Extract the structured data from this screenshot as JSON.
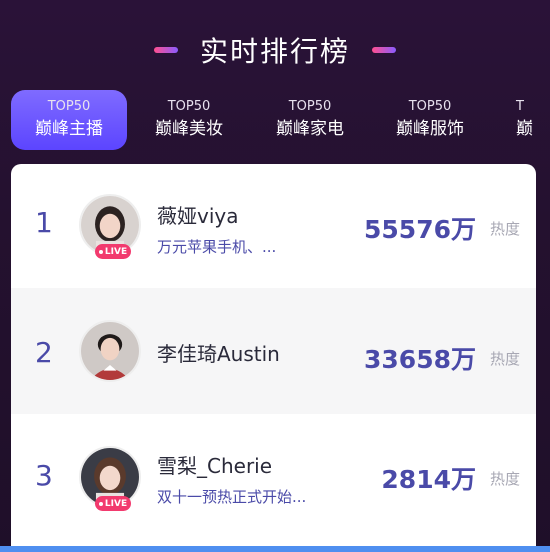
{
  "header": {
    "title": "实时排行榜"
  },
  "tabs": [
    {
      "top": "TOP50",
      "label": "巅峰主播",
      "active": true
    },
    {
      "top": "TOP50",
      "label": "巅峰美妆"
    },
    {
      "top": "TOP50",
      "label": "巅峰家电"
    },
    {
      "top": "TOP50",
      "label": "巅峰服饰"
    },
    {
      "top": "T",
      "label": "巅"
    }
  ],
  "ranking": [
    {
      "rank": "1",
      "name": "薇娅viya",
      "subtitle": "万元苹果手机、...",
      "value": "55576万",
      "heat_label": "热度",
      "live": "LIVE"
    },
    {
      "rank": "2",
      "name": "李佳琦Austin",
      "subtitle": "",
      "value": "33658万",
      "heat_label": "热度"
    },
    {
      "rank": "3",
      "name": "雪梨_Cherie",
      "subtitle": "双十一预热正式开始...",
      "value": "2814万",
      "heat_label": "热度",
      "live": "LIVE"
    }
  ],
  "colors": {
    "background": "#24112f",
    "accent": "#5c45ff",
    "rank_text": "#4a4aa8",
    "live_badge": "#f23a6e"
  },
  "icons": [
    "title-bar-left-icon",
    "title-bar-right-icon",
    "avatar-viya",
    "avatar-austin",
    "avatar-cherie",
    "live-dot-icon"
  ]
}
